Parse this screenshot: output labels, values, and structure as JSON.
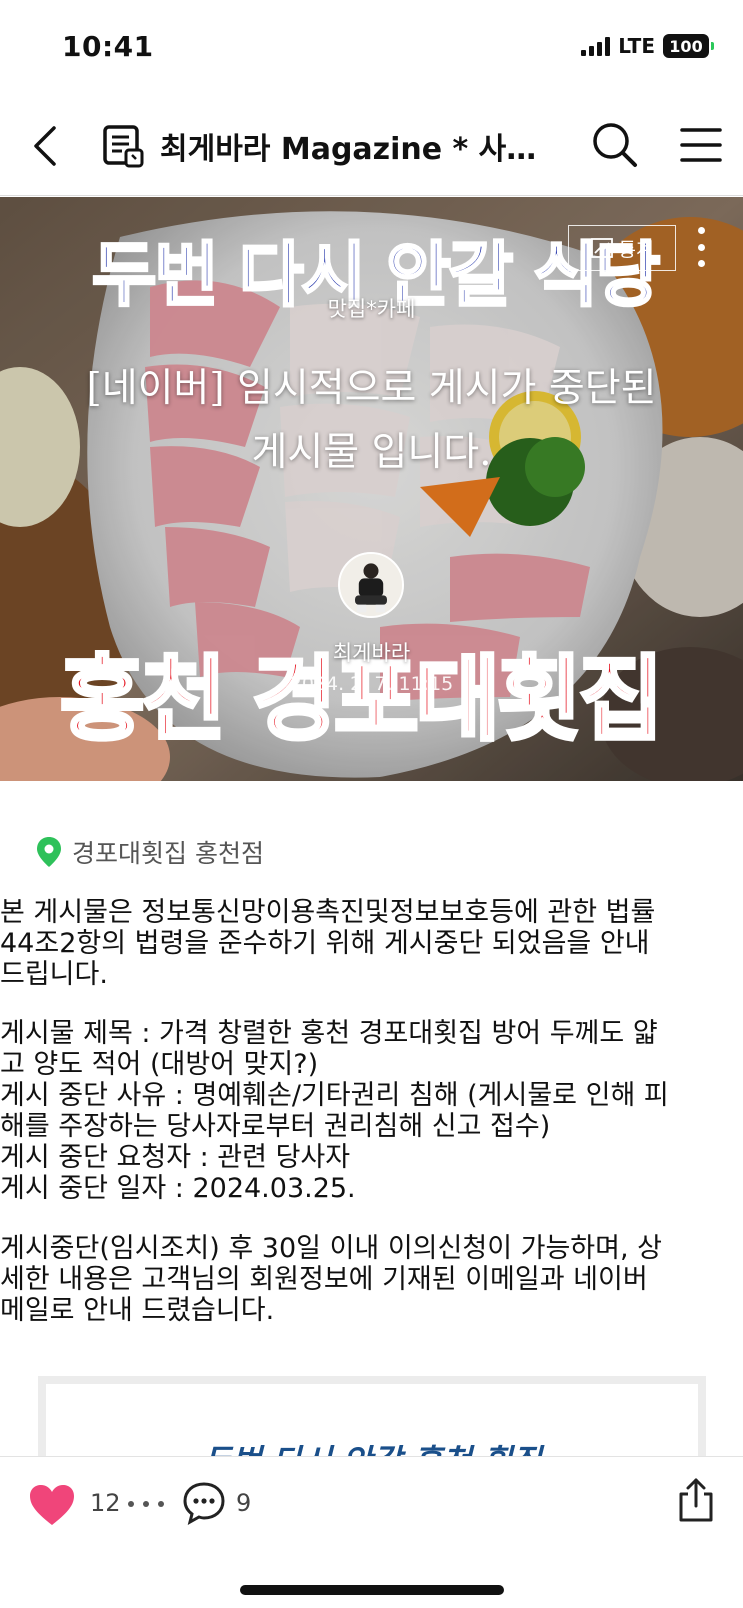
{
  "status_bar": {
    "time": "10:41",
    "network": "LTE",
    "battery": "100"
  },
  "nav": {
    "title": "최게바라 Magazine * 사진 ..."
  },
  "hero": {
    "banner_top": "두번 다시 안갈 식당",
    "banner_bottom": "홍천 경포대횟집",
    "stats_label": "통계",
    "category": "맛집*카페",
    "title_line1": "[네이버] 임시적으로 게시가 중단된",
    "title_line2": "게시물 입니다.",
    "author": "최게바라",
    "date": "2024. 2. 7. 11:15"
  },
  "place": {
    "name": "경포대횟집 홍천점",
    "icon": "map-pin-icon"
  },
  "body": {
    "p1": [
      "본 게시물은 정보통신망이용촉진및정보보호등에 관한 법률",
      "44조2항의 법령을 준수하기 위해 게시중단 되었음을 안내",
      "드립니다."
    ],
    "p2": [
      "게시물 제목 : 가격 창렬한 홍천 경포대횟집 방어 두께도 얇",
      "고 양도 적어 (대방어 맞지?)",
      "게시 중단 사유 : 명예훼손/기타권리 침해 (게시물로 인해 피",
      "해를 주장하는 당사자로부터 권리침해 신고 접수)",
      "게시 중단 요청자 : 관련 당사자",
      "게시 중단 일자 : 2024.03.25."
    ],
    "p3": [
      "게시중단(임시조치) 후 30일 이내 이의신청이 가능하며, 상",
      "세한 내용은 고객님의 회원정보에 기재된 이메일과 네이버",
      "메일로 안내 드렸습니다."
    ],
    "quote_partial": "두번 다시 안갈 홍천 횟집"
  },
  "bottom_bar": {
    "like_count": "12",
    "comment_count": "9"
  },
  "colors": {
    "like": "#f0457a",
    "banner_blue": "#1d2fa8",
    "banner_red": "#e5101c",
    "pin_green": "#2ec15a"
  }
}
